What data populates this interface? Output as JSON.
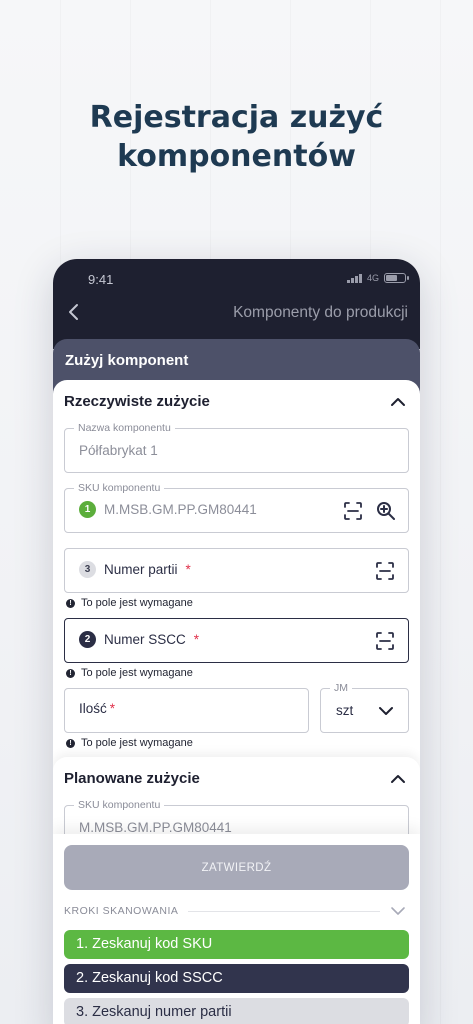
{
  "hero": {
    "line1": "Rejestracja zużyć",
    "line2": "komponentów"
  },
  "status": {
    "time": "9:41",
    "network": "4G"
  },
  "nav": {
    "title": "Komponenty do produkcji"
  },
  "sheet": {
    "title": "Zużyj komponent"
  },
  "actual": {
    "title": "Rzeczywiste zużycie",
    "component_name": {
      "label": "Nazwa komponentu",
      "value": "Półfabrykat 1"
    },
    "sku": {
      "label": "SKU komponentu",
      "step": "1",
      "value": "M.MSB.GM.PP.GM80441"
    },
    "batch": {
      "step": "3",
      "label": "Numer partii",
      "required": "*",
      "error": "To pole jest wymagane"
    },
    "sscc": {
      "step": "2",
      "label": "Numer SSCC",
      "required": "*",
      "error": "To pole jest wymagane"
    },
    "quantity": {
      "label": "Ilość",
      "required": "*",
      "error": "To pole jest wymagane"
    },
    "unit": {
      "label": "JM",
      "value": "szt"
    }
  },
  "planned": {
    "title": "Planowane zużycie",
    "sku": {
      "label": "SKU komponentu",
      "value": "M.MSB.GM.PP.GM80441"
    }
  },
  "actions": {
    "confirm": "ZATWIERDŹ"
  },
  "steps": {
    "title": "KROKI SKANOWANIA",
    "items": [
      "1. Zeskanuj kod SKU",
      "2. Zeskanuj kod SSCC",
      "3. Zeskanuj numer partii"
    ]
  },
  "colors": {
    "brand_dark": "#1e2030",
    "sheet": "#4d5169",
    "success": "#5cb843",
    "required": "#e0304a",
    "title": "#1e3a52"
  },
  "icons": [
    "back-icon",
    "signal-icon",
    "battery-icon",
    "chevron-up-icon",
    "scan-icon",
    "zoom-icon",
    "error-icon",
    "chevron-down-icon"
  ]
}
